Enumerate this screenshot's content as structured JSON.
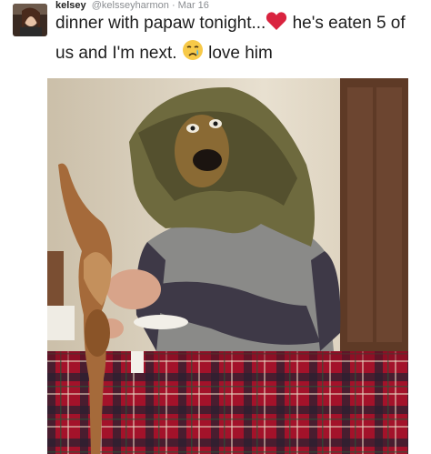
{
  "tweet": {
    "display_name": "kelsey",
    "handle": "@kelsseyharmon",
    "separator": "·",
    "date": "Mar 16",
    "text_part1": "dinner with papaw tonight...",
    "text_part2": " he's eaten 5 of us and I'm next. ",
    "text_part3": " love him",
    "emojis": [
      "heart-emoji",
      "crying-face-emoji"
    ]
  },
  "colors": {
    "heart": "#d9233f",
    "tablecloth_red": "#a3122a",
    "tablecloth_dark": "#2a2030",
    "wall": "#dcd2c0",
    "door": "#5e3a26"
  }
}
